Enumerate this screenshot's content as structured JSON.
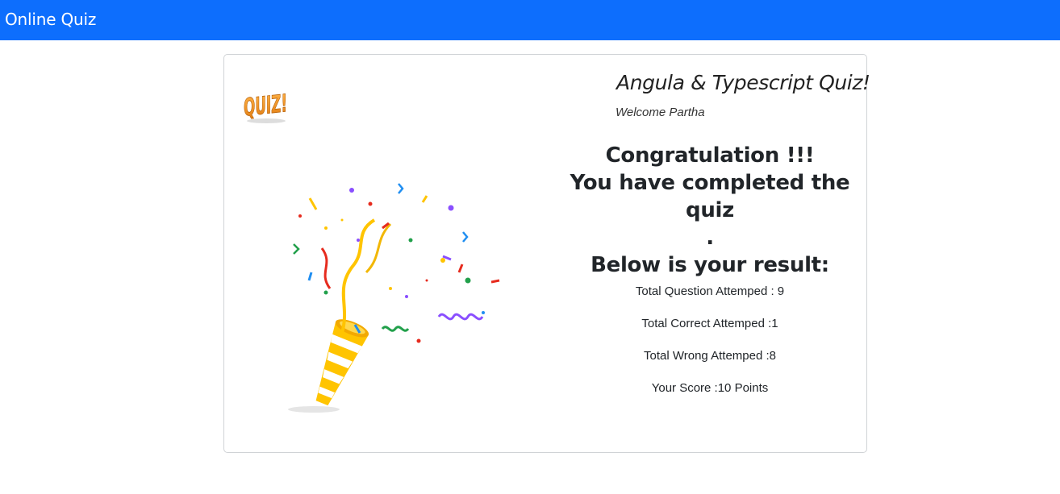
{
  "navbar": {
    "brand": "Online Quiz"
  },
  "card": {
    "logo": {
      "icon": "quiz-logo-icon",
      "text": "QUIZ!"
    },
    "illustration": {
      "icon": "party-popper-icon"
    },
    "title": "Angula & Typescript Quiz!",
    "welcome": "Welcome Partha",
    "congrats_line1": "Congratulation !!!",
    "congrats_line2": "You have completed the quiz",
    "congrats_line3": ".",
    "result_heading": "Below is your result:",
    "stats": [
      "Total Question Attemped : 9",
      "Total Correct Attemped :1",
      "Total Wrong Attemped :8",
      "Your Score :10 Points"
    ]
  },
  "colors": {
    "navbar": "#0d6efd",
    "logo_orange": "#f7941d",
    "popper_yellow": "#ffcc1e"
  }
}
